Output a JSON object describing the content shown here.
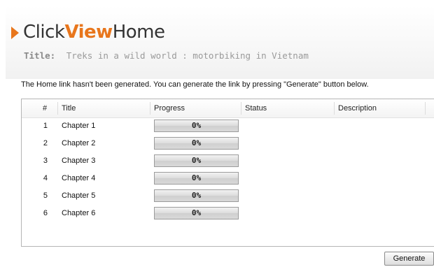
{
  "logo": {
    "part1": "Click",
    "part2": "View",
    "part3": "Home",
    "accent_color": "#e8761c"
  },
  "title": {
    "label": "Title:",
    "value": "Treks in a wild world : motorbiking in Vietnam"
  },
  "info_text": "The Home link hasn't been generated. You can generate the link by pressing \"Generate\" button below.",
  "table": {
    "columns": [
      "#",
      "Title",
      "Progress",
      "Status",
      "Description"
    ],
    "rows": [
      {
        "num": "1",
        "title": "Chapter 1",
        "progress": "0%",
        "progress_value": 0,
        "status": "",
        "description": ""
      },
      {
        "num": "2",
        "title": "Chapter 2",
        "progress": "0%",
        "progress_value": 0,
        "status": "",
        "description": ""
      },
      {
        "num": "3",
        "title": "Chapter 3",
        "progress": "0%",
        "progress_value": 0,
        "status": "",
        "description": ""
      },
      {
        "num": "4",
        "title": "Chapter 4",
        "progress": "0%",
        "progress_value": 0,
        "status": "",
        "description": ""
      },
      {
        "num": "5",
        "title": "Chapter 5",
        "progress": "0%",
        "progress_value": 0,
        "status": "",
        "description": ""
      },
      {
        "num": "6",
        "title": "Chapter 6",
        "progress": "0%",
        "progress_value": 0,
        "status": "",
        "description": ""
      }
    ]
  },
  "generate_button": "Generate"
}
